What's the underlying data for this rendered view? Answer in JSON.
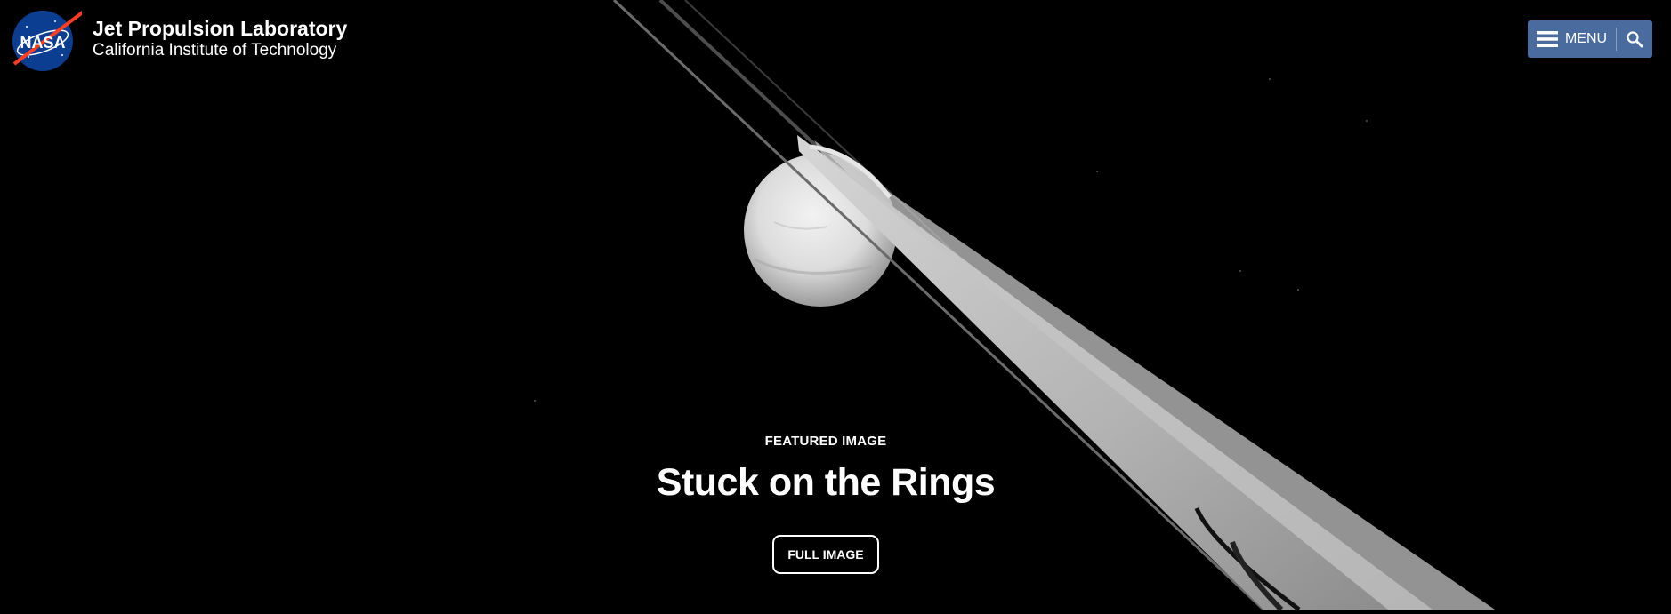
{
  "header": {
    "logo_icon": "nasa-meatball-icon",
    "logo_wordmark": "NASA",
    "org_name": "Jet Propulsion Laboratory",
    "org_subtitle": "California Institute of Technology"
  },
  "nav": {
    "menu_label": "MENU",
    "menu_icon": "hamburger-icon",
    "search_icon": "search-icon",
    "bg_color": "#4a6b9e"
  },
  "feature": {
    "label": "FEATURED IMAGE",
    "title": "Stuck on the Rings",
    "button_label": "FULL IMAGE"
  }
}
